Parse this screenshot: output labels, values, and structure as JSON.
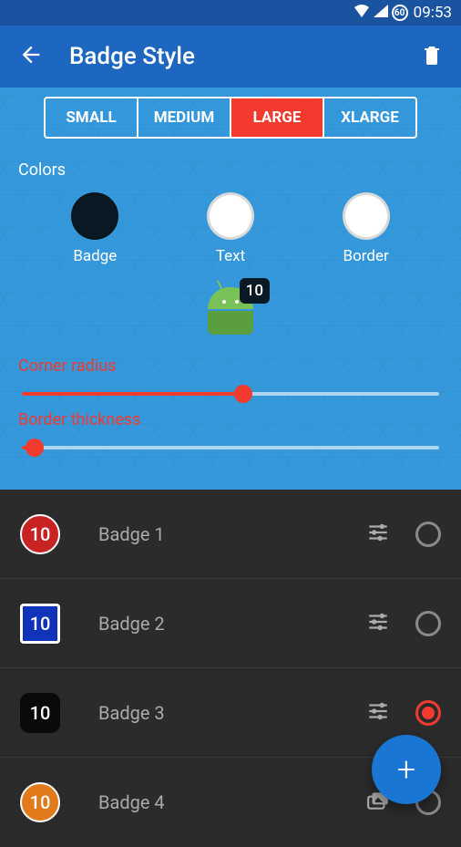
{
  "statusbar": {
    "battery_icon": "60",
    "time": "09:53"
  },
  "appbar": {
    "title": "Badge Style"
  },
  "sizes": {
    "small": "SMALL",
    "medium": "MEDIUM",
    "large": "LARGE",
    "xlarge": "XLARGE",
    "selected": "LARGE"
  },
  "colors": {
    "heading": "Colors",
    "badge_label": "Badge",
    "text_label": "Text",
    "border_label": "Border"
  },
  "preview": {
    "badge_value": "10"
  },
  "sliders": {
    "corner_radius": {
      "label": "Corner radius",
      "percent": 53
    },
    "border_thickness": {
      "label": "Border thickness",
      "percent": 3
    }
  },
  "badges": [
    {
      "name": "Badge 1",
      "value": "10",
      "style": "red",
      "selected": false
    },
    {
      "name": "Badge 2",
      "value": "10",
      "style": "blue",
      "selected": false
    },
    {
      "name": "Badge 3",
      "value": "10",
      "style": "black",
      "selected": true
    },
    {
      "name": "Badge 4",
      "value": "10",
      "style": "orange",
      "selected": false
    }
  ],
  "fab": {
    "label": "+"
  }
}
